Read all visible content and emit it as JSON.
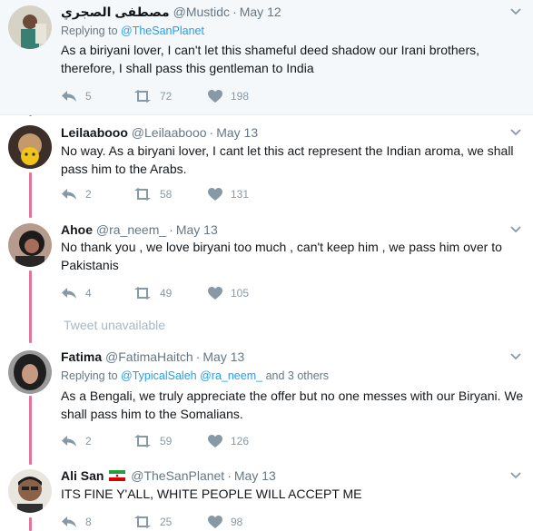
{
  "colors": {
    "thread": "#e0779b",
    "link": "#1da1f2",
    "muted": "#657786",
    "icon": "#8899a6",
    "highlight": "#f5f8fa"
  },
  "tweets": [
    {
      "name": "مصطفى الصجري",
      "handle": "@Mustidc",
      "date": "May 12",
      "replying_prefix": "Replying to",
      "replying_to": "@TheSanPlanet",
      "text": "As a biriyani lover, I can't let this shameful deed shadow our Irani brothers, therefore, I shall pass this gentleman to India",
      "replies": "5",
      "retweets": "72",
      "likes": "198"
    },
    {
      "name": "Leilaabooo",
      "handle": "@Leilaabooo",
      "date": "May 13",
      "text": "No way. As a biryani lover, I cant let this act represent the Indian aroma, we shall pass him to the Arabs.",
      "replies": "2",
      "retweets": "58",
      "likes": "131"
    },
    {
      "name": "Ahoe",
      "handle": "@ra_neem_",
      "date": "May 13",
      "text": "No thank you , we love biryani too much , can't keep him , we pass him over to Pakistanis",
      "replies": "4",
      "retweets": "49",
      "likes": "105"
    },
    {
      "name": "Fatima",
      "handle": "@FatimaHaitch",
      "date": "May 13",
      "replying_prefix": "Replying to",
      "replying_to": "@TypicalSaleh",
      "replying_to_2": "@ra_neem_",
      "replying_suffix": "and 3 others",
      "text": "As a Bengali, we truly appreciate the offer but no one messes with our Biryani. We shall pass him to the Somalians.",
      "replies": "2",
      "retweets": "59",
      "likes": "126"
    },
    {
      "name": "Ali San",
      "flag": "iran-flag-icon",
      "handle": "@TheSanPlanet",
      "date": "May 13",
      "text": "ITS FINE Y'ALL, WHITE PEOPLE WILL ACCEPT ME",
      "replies": "8",
      "retweets": "25",
      "likes": "98"
    }
  ],
  "unavailable": "Tweet unavailable",
  "icons": {
    "reply": "reply-icon",
    "retweet": "retweet-icon",
    "like": "heart-icon",
    "menu": "chevron-down-icon"
  }
}
